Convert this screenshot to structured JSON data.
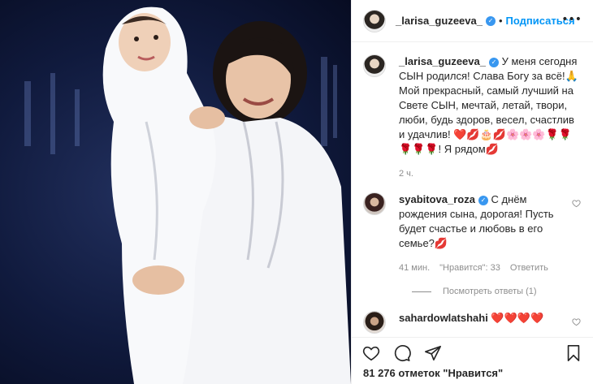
{
  "post": {
    "author": "_larisa_guzeeva_",
    "follow_label": "Подписаться",
    "dot": "•",
    "more": "•••",
    "verified_mark": "✓"
  },
  "caption": {
    "username": "_larisa_guzeeva_",
    "text": " У меня сегодня СЫН родился! Слава Богу за всё!🙏 Мой прекрасный, самый лучший на Свете СЫН, мечтай, летай, твори, люби, будь здоров, весел, счастлив и удачлив! ❤️💋🎂💋🌸🌸🌸🌹🌹🌹🌹🌹! Я рядом💋",
    "time": "2 ч."
  },
  "comments": [
    {
      "username": "syabitova_roza",
      "text": " С днём рождения сына, дорогая! Пусть будет счастье и любовь в его семье?💋",
      "time": "41 мин.",
      "likes": "\"Нравится\": 33",
      "reply_label": "Ответить",
      "view_replies": "Посмотреть ответы (1)"
    },
    {
      "username": "sahardowlatshahi",
      "text": " ❤️❤️❤️❤️"
    }
  ],
  "likes_text": "81 276 отметок \"Нравится\"",
  "icons": {
    "like": "heart-icon",
    "comment": "comment-icon",
    "share": "share-icon",
    "save": "bookmark-icon",
    "comment_like": "heart-outline-icon"
  },
  "colors": {
    "link_blue": "#0095f6",
    "verified_blue": "#3897f0",
    "muted_text": "#8e8e8e",
    "border": "#efefef"
  }
}
